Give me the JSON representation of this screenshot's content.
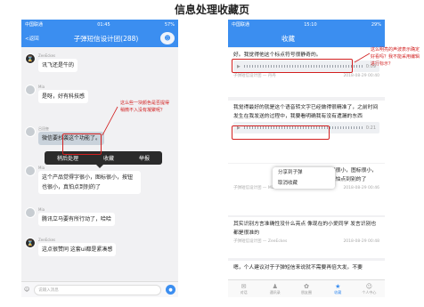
{
  "title": "信息处理收藏页",
  "chat": {
    "status": {
      "carrier": "中国联通",
      "time": "01:45",
      "battery": "57%"
    },
    "back": "<返回",
    "nav_title": "子弹短信设计团(288)",
    "messages": [
      {
        "name": "ZeeEckes",
        "text": "讯飞还是牛的",
        "avatar": "dark"
      },
      {
        "name": "Mia",
        "text": "是呀，好有科技感",
        "avatar": "photo"
      },
      {
        "name": "吕冠奎",
        "text": "微信要抄袭这个功能了。",
        "avatar": "photo"
      },
      {
        "name": "Mia",
        "text": "这个产品觉得字很小，图标很小，按钮也很小，真怕点到别的了",
        "avatar": "photo"
      },
      {
        "name": "Mia",
        "text": "腾讯立马要有所行动了，哈哈",
        "avatar": "photo"
      },
      {
        "name": "ZeeEckes",
        "text": "这点很赞同 这套ui都是紧凑感",
        "avatar": "dark"
      }
    ],
    "popup": [
      "稍后处理",
      "收藏",
      "举报"
    ],
    "annotation": "这么些一块颜色是否提得稍微不入没有凝聚呢？",
    "input_placeholder": "说输入消息"
  },
  "fav": {
    "status": {
      "carrier": "中国联通",
      "time": "15:10",
      "battery": "29%"
    },
    "nav_title": "收藏",
    "cards": [
      {
        "text": "好。我觉得他这个标点符号很静奇的。",
        "voice": "0:09",
        "sender": "子弹短信设计团 — 丹丹",
        "date": "2018-08-29 00:40"
      },
      {
        "text": "我觉得最好的就是这个语音转文字已经做得很精准了，之前时间发生在我发送的过程中，我要看明确我有没有遗漏的东西",
        "voice": "0:21",
        "sender": "子弹短信设计团 — Mia",
        "date": "2018-08-29 00:45"
      },
      {
        "text": "这个产品觉得字很小，图标很小，按钮也很小，真怕点到别的了",
        "voice": "",
        "sender": "子弹短信设计团 — Mia",
        "date": "2018-08-29 00:46"
      },
      {
        "text": "其实识别方言准确性没什么亮点 像现在的小爱同学 发言识别也都是很准的",
        "voice": "",
        "sender": "子弹短信设计团 — ZeeEckes",
        "date": "2018-08-29 00:48"
      },
      {
        "text": "嗯，个人建议对于子弹短信来说就不需要再倍大发。不要",
        "voice": "",
        "sender": "",
        "date": ""
      }
    ],
    "menu": [
      "分享到子弹",
      "取消收藏"
    ],
    "annotation": "这么明亮的声波表示确定好看吗？我不能采用编辑进行标示？",
    "tabs": [
      {
        "label": "对话",
        "icon": "chat-icon"
      },
      {
        "label": "通讯录",
        "icon": "contacts-icon"
      },
      {
        "label": "朋友圈",
        "icon": "moments-icon"
      },
      {
        "label": "收藏",
        "icon": "star-icon",
        "active": true
      },
      {
        "label": "个人中心",
        "icon": "person-icon"
      }
    ]
  }
}
